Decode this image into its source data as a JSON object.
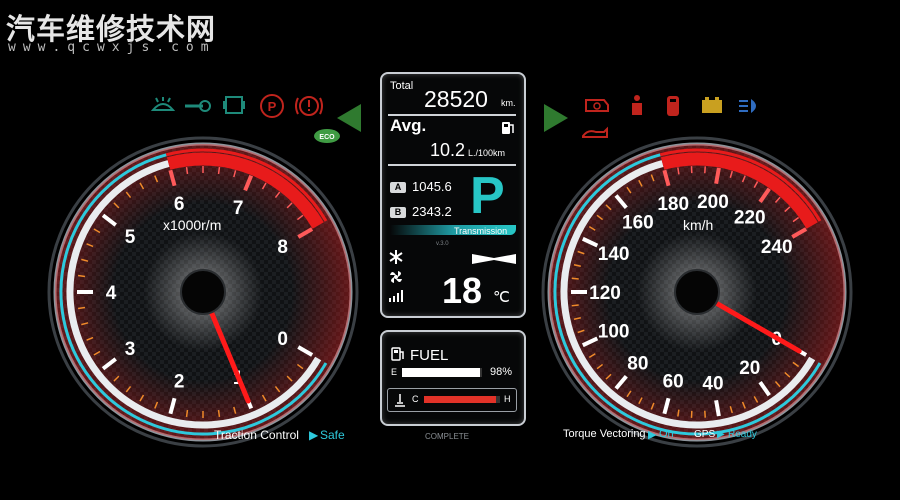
{
  "watermark": {
    "title": "汽车维修技术网",
    "url": "www.qcwxjs.com"
  },
  "colors": {
    "accent": "#2ec9dc",
    "redline": "#e81b1b",
    "needle": "#ff1a1a",
    "warning_green": "#1e8a7a",
    "warning_red": "#c0241d",
    "eco": "#4caf50"
  },
  "tachometer": {
    "unit": "x1000r/m",
    "ticks": [
      "0",
      "1",
      "2",
      "3",
      "4",
      "5",
      "6",
      "7",
      "8"
    ],
    "reading": 1.0,
    "max": 8,
    "redline_from": 6
  },
  "speedometer": {
    "unit": "km/h",
    "ticks": [
      "0",
      "20",
      "40",
      "60",
      "80",
      "100",
      "120",
      "140",
      "160",
      "180",
      "200",
      "220",
      "240"
    ],
    "reading": 0,
    "max": 240,
    "redline_from": 180
  },
  "left_indicators": [
    "washer-icon",
    "wrench-icon",
    "tpms-icon",
    "parking-brake-icon",
    "brake-warning-icon",
    "turn-left-icon"
  ],
  "right_indicators": [
    "turn-right-icon",
    "check-engine-icon",
    "seatbelt-icon",
    "door-open-icon",
    "battery-icon",
    "headlight-icon"
  ],
  "eco_badge": "ECO",
  "info": {
    "total_label": "Total",
    "total_value": "28520",
    "total_unit": "km.",
    "avg_label": "Avg.",
    "avg_value": "10.2",
    "avg_unit": "L./100km",
    "tripA_label": "A",
    "tripA_value": "1045.6",
    "tripB_label": "B",
    "tripB_value": "2343.2",
    "gear": "P",
    "transmission_label": "Transmission",
    "version": "v.3.0",
    "temperature": "18",
    "temperature_unit": "℃"
  },
  "fuel": {
    "label": "FUEL",
    "empty_label": "E",
    "level": 0.98,
    "percent_text": "98%",
    "coolant_cold_label": "C",
    "coolant_hot_label": "H",
    "coolant_level": 0.95
  },
  "footer": {
    "complete": "COMPLETE",
    "traction_label": "Traction Control",
    "traction_value": "Safe",
    "torque_label": "Torque Vectoring",
    "torque_value": "On",
    "gps_label": "GPS",
    "gps_value": "Ready"
  }
}
